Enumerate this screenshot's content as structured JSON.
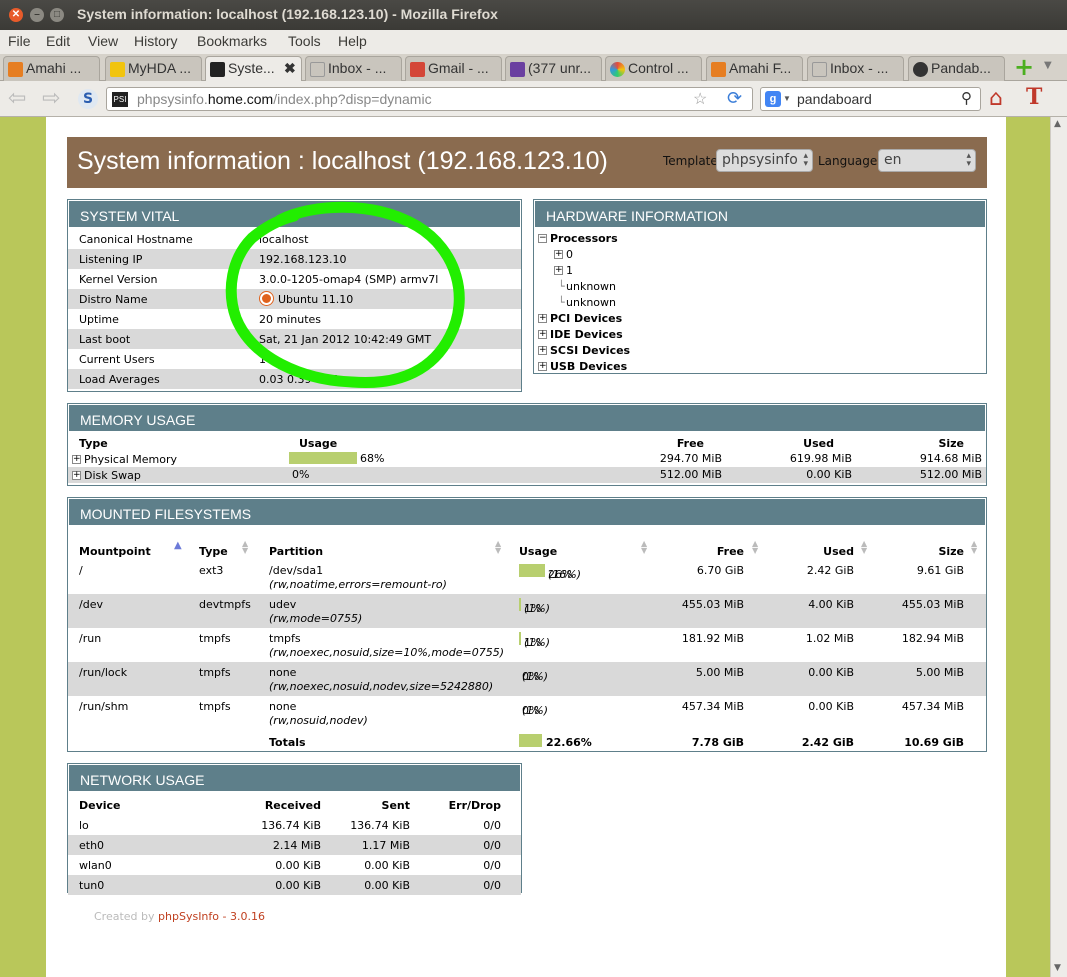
{
  "window": {
    "title": "System information: localhost (192.168.123.10) - Mozilla Firefox"
  },
  "menu": [
    "File",
    "Edit",
    "View",
    "History",
    "Bookmarks",
    "Tools",
    "Help"
  ],
  "tabs": [
    {
      "label": "Amahi ...",
      "color": "#e67e22"
    },
    {
      "label": "MyHDA ...",
      "color": "#f1c40f"
    },
    {
      "label": "Syste...",
      "color": "#222222",
      "active": true
    },
    {
      "label": "Inbox - ...",
      "color": "#c9c5bd"
    },
    {
      "label": "Gmail - ...",
      "color": "#d44638"
    },
    {
      "label": "(377 unr...",
      "color": "#6a3fa0"
    },
    {
      "label": "Control ...",
      "color": "#4a90e2"
    },
    {
      "label": "Amahi F...",
      "color": "#e67e22"
    },
    {
      "label": "Inbox - ...",
      "color": "#c9c5bd"
    },
    {
      "label": "Pandab...",
      "color": "#333333"
    }
  ],
  "nav": {
    "url_host": "phpsysinfo.home.com",
    "url_prefix": "phpsysinfo.",
    "url_domain": "home.com",
    "url_path": "/index.php?disp=dynamic",
    "search": "pandaboard"
  },
  "header": {
    "title": "System information : localhost (192.168.123.10)",
    "template_label": "Template",
    "template_value": "phpsysinfo",
    "language_label": "Language",
    "language_value": "en"
  },
  "vital": {
    "heading": "SYSTEM VITAL",
    "rows": [
      {
        "k": "Canonical Hostname",
        "v": "localhost"
      },
      {
        "k": "Listening IP",
        "v": "192.168.123.10"
      },
      {
        "k": "Kernel Version",
        "v": "3.0.0-1205-omap4 (SMP) armv7l"
      },
      {
        "k": "Distro Name",
        "v": "Ubuntu 11.10"
      },
      {
        "k": "Uptime",
        "v": "20 minutes"
      },
      {
        "k": "Last boot",
        "v": "Sat, 21 Jan 2012 10:42:49 GMT"
      },
      {
        "k": "Current Users",
        "v": "1"
      },
      {
        "k": "Load Averages",
        "v": "0.03 0.39 0.41"
      }
    ]
  },
  "hardware": {
    "heading": "HARDWARE INFORMATION",
    "processors": "Processors",
    "p0": "0",
    "p1": "1",
    "unk1": "unknown",
    "unk2": "unknown",
    "pci": "PCI Devices",
    "ide": "IDE Devices",
    "scsi": "SCSI Devices",
    "usb": "USB Devices"
  },
  "memory": {
    "heading": "MEMORY USAGE",
    "cols": {
      "type": "Type",
      "usage": "Usage",
      "free": "Free",
      "used": "Used",
      "size": "Size"
    },
    "rows": [
      {
        "type": "Physical Memory",
        "pct": 68,
        "usage": "68%",
        "free": "294.70 MiB",
        "used": "619.98 MiB",
        "size": "914.68 MiB"
      },
      {
        "type": "Disk Swap",
        "pct": 0,
        "usage": "0%",
        "free": "512.00 MiB",
        "used": "0.00 KiB",
        "size": "512.00 MiB"
      }
    ]
  },
  "filesystems": {
    "heading": "MOUNTED FILESYSTEMS",
    "cols": {
      "mount": "Mountpoint",
      "type": "Type",
      "part": "Partition",
      "usage": "Usage",
      "free": "Free",
      "used": "Used",
      "size": "Size"
    },
    "rows": [
      {
        "mount": "/",
        "type": "ext3",
        "part": "/dev/sda1",
        "opts": "(rw,noatime,errors=remount-ro)",
        "pct": 26,
        "usage": "26%",
        "inodes": "(16%)",
        "free": "6.70 GiB",
        "used": "2.42 GiB",
        "size": "9.61 GiB"
      },
      {
        "mount": "/dev",
        "type": "devtmpfs",
        "part": "udev",
        "opts": "(rw,mode=0755)",
        "pct": 1,
        "usage": "1%",
        "inodes": "(1%)",
        "free": "455.03 MiB",
        "used": "4.00 KiB",
        "size": "455.03 MiB"
      },
      {
        "mount": "/run",
        "type": "tmpfs",
        "part": "tmpfs",
        "opts": "(rw,noexec,nosuid,size=10%,mode=0755)",
        "pct": 1,
        "usage": "1%",
        "inodes": "(1%)",
        "free": "181.92 MiB",
        "used": "1.02 MiB",
        "size": "182.94 MiB"
      },
      {
        "mount": "/run/lock",
        "type": "tmpfs",
        "part": "none",
        "opts": "(rw,noexec,nosuid,nodev,size=5242880)",
        "pct": 0,
        "usage": "0%",
        "inodes": "(1%)",
        "free": "5.00 MiB",
        "used": "0.00 KiB",
        "size": "5.00 MiB"
      },
      {
        "mount": "/run/shm",
        "type": "tmpfs",
        "part": "none",
        "opts": "(rw,nosuid,nodev)",
        "pct": 0,
        "usage": "0%",
        "inodes": "(1%)",
        "free": "457.34 MiB",
        "used": "0.00 KiB",
        "size": "457.34 MiB"
      }
    ],
    "totals": {
      "label": "Totals",
      "pct": 22.66,
      "usage": "22.66%",
      "free": "7.78 GiB",
      "used": "2.42 GiB",
      "size": "10.69 GiB"
    }
  },
  "network": {
    "heading": "NETWORK USAGE",
    "cols": {
      "dev": "Device",
      "rx": "Received",
      "tx": "Sent",
      "err": "Err/Drop"
    },
    "rows": [
      {
        "dev": "lo",
        "rx": "136.74 KiB",
        "tx": "136.74 KiB",
        "err": "0/0"
      },
      {
        "dev": "eth0",
        "rx": "2.14 MiB",
        "tx": "1.17 MiB",
        "err": "0/0"
      },
      {
        "dev": "wlan0",
        "rx": "0.00 KiB",
        "tx": "0.00 KiB",
        "err": "0/0"
      },
      {
        "dev": "tun0",
        "rx": "0.00 KiB",
        "tx": "0.00 KiB",
        "err": "0/0"
      }
    ]
  },
  "footer": {
    "prefix": "Created by ",
    "link": "phpSysInfo - 3.0.16"
  },
  "annotation_color": "#22ee00"
}
